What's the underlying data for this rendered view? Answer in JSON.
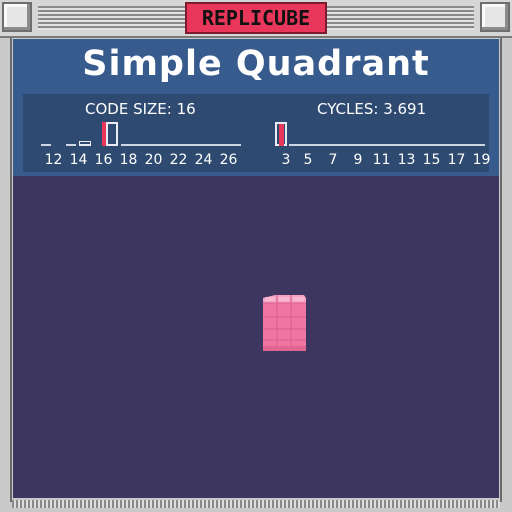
{
  "window": {
    "title": "REPLICUBE"
  },
  "level": {
    "title": "Simple Quadrant"
  },
  "stats": {
    "code_size": {
      "label": "CODE SIZE: 16",
      "ticks": [
        "12",
        "14",
        "16",
        "18",
        "20",
        "22",
        "24",
        "26"
      ],
      "marker_color": "#e8375a"
    },
    "cycles": {
      "label": "CYCLES: 3.691",
      "ticks": [
        "3",
        "5",
        "7",
        "9",
        "11",
        "13",
        "15",
        "17",
        "19"
      ],
      "marker_color": "#e8375a"
    }
  },
  "scene": {
    "object": "pink-cube",
    "cube_color": "#f07aa6",
    "background_color": "#3d3661"
  }
}
